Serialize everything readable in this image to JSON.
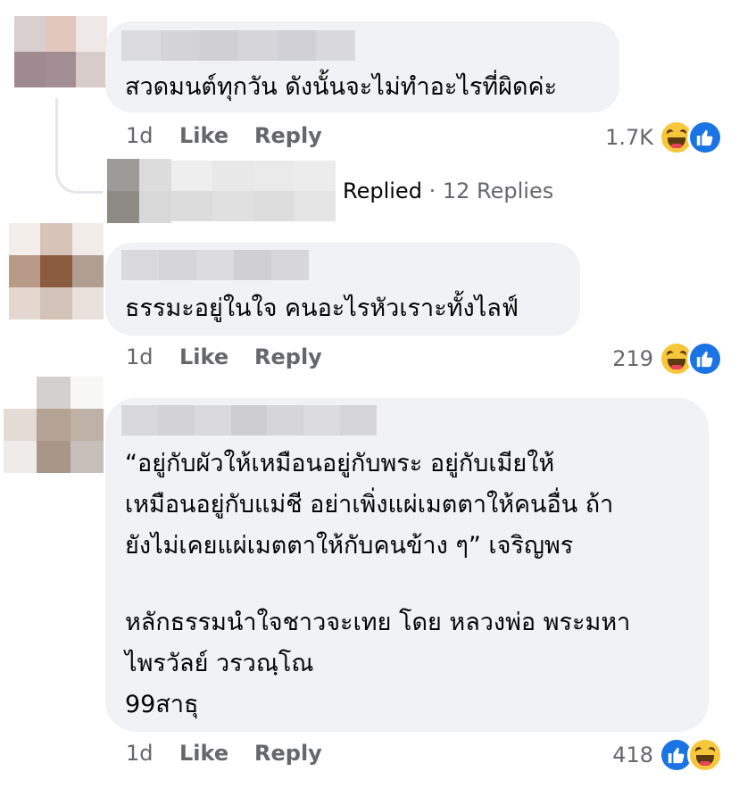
{
  "comments": [
    {
      "text_lines": [
        "สวดมนต์ทุกวัน ดังนั้นจะไม่ทำอะไรที่ผิดค่ะ"
      ],
      "time": "1d",
      "like_label": "Like",
      "reply_label": "Reply",
      "reaction_count": "1.7K",
      "reactions": [
        "haha-icon",
        "like-icon"
      ]
    },
    {
      "text_lines": [
        "ธรรมะอยู่ในใจ คนอะไรหัวเราะทั้งไลฟ์"
      ],
      "time": "1d",
      "like_label": "Like",
      "reply_label": "Reply",
      "reaction_count": "219",
      "reactions": [
        "haha-icon",
        "like-icon"
      ]
    },
    {
      "text_lines": [
        "“อยู่กับผัวให้เหมือนอยู่กับพระ  อยู่กับเมียให้",
        "เหมือนอยู่กับแม่ชี อย่าเพิ่งแผ่เมตตาให้คนอื่น ถ้า",
        "ยังไม่เคยแผ่เมตตาให้กับคนข้าง ๆ” เจริญพร",
        "",
        "หลักธรรมนำใจชาวจะเทย โดย หลวงพ่อ พระมหา",
        "ไพรวัลย์ วรวณฺโณ",
        "99สาธุ"
      ],
      "time": "1d",
      "like_label": "Like",
      "reply_label": "Reply",
      "reaction_count": "418",
      "reactions": [
        "like-icon",
        "haha-icon"
      ]
    }
  ],
  "reply_summary": {
    "label": "Replied",
    "separator": "·",
    "count": "12 Replies"
  },
  "colors": {
    "bubble": "#f0f2f5",
    "secondary_text": "#65676b",
    "like_blue": "#1b74e4",
    "haha_yellow": "#f7c73b"
  }
}
